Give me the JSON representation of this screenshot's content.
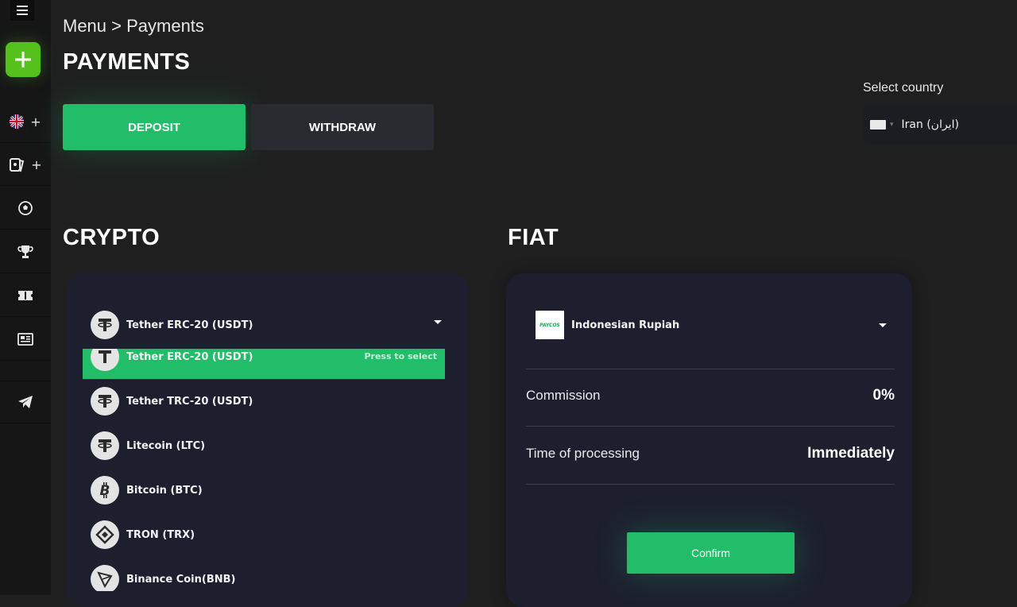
{
  "breadcrumb": {
    "text": "Menu > Payments"
  },
  "page_title": "PAYMENTS",
  "tabs": {
    "deposit": "DEPOSIT",
    "withdraw": "WITHDRAW"
  },
  "country": {
    "label": "Select country",
    "value": "Iran (ایران)"
  },
  "sidebar": {
    "items": [
      {
        "icon": "uk-flag-icon",
        "has_plus": true,
        "plus": "+"
      },
      {
        "icon": "cards-icon",
        "has_plus": true,
        "plus": "+"
      },
      {
        "icon": "soccer-ball-icon"
      },
      {
        "icon": "trophy-icon"
      },
      {
        "icon": "ticket-icon"
      },
      {
        "icon": "news-icon"
      },
      {
        "icon": "telegram-icon"
      }
    ]
  },
  "crypto": {
    "title": "CRYPTO",
    "selected": "Tether ERC-20 (USDT)",
    "press_hint": "Press to select",
    "options": [
      {
        "label": "Tether ERC-20 (USDT)",
        "icon": "tether-icon"
      },
      {
        "label": "Tether TRC-20 (USDT)",
        "icon": "tether-icon"
      },
      {
        "label": "Litecoin (LTC)",
        "icon": "tether-icon"
      },
      {
        "label": "Bitcoin (BTC)",
        "icon": "bitcoin-icon"
      },
      {
        "label": "TRON (TRX)",
        "icon": "binance-icon"
      },
      {
        "label": "Binance Coin(BNB)",
        "icon": "tron-icon"
      }
    ]
  },
  "fiat": {
    "title": "FIAT",
    "selected": "Indonesian Rupiah",
    "logo_text": "PAYCOS",
    "commission_label": "Commission",
    "commission_value": "0%",
    "processing_label": "Time of processing",
    "processing_value": "Immediately",
    "confirm_label": "Confirm"
  },
  "colors": {
    "accent_green": "#22bd68",
    "add_green": "#55c11d",
    "panel_bg": "#1d1f2f",
    "page_bg": "#1f1f20"
  }
}
